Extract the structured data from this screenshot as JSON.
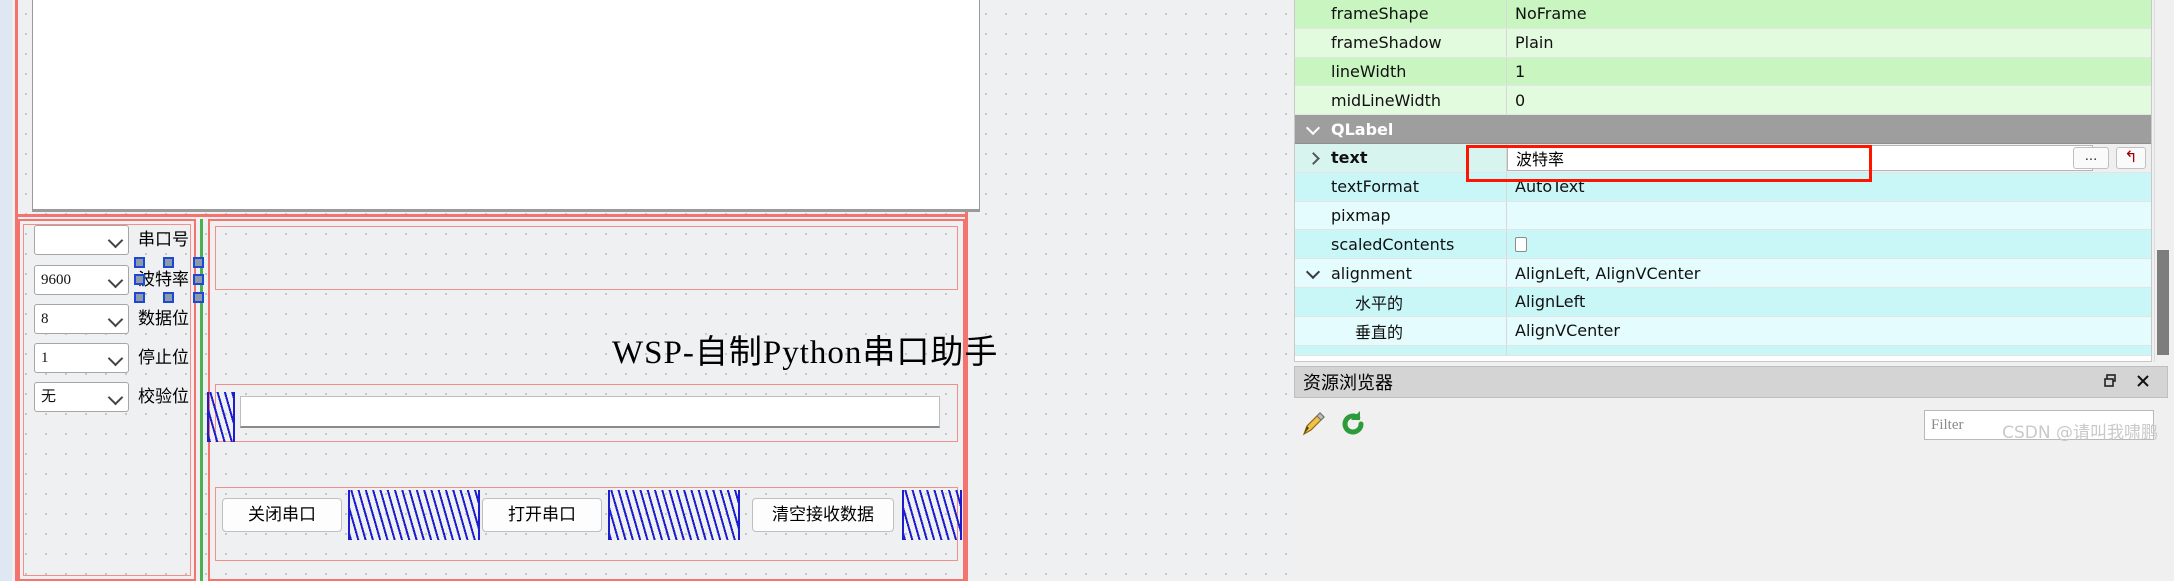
{
  "designer": {
    "form_title": "WSP-自制Python串口助手",
    "left_rows": [
      {
        "value": "",
        "label": "串口号"
      },
      {
        "value": "9600",
        "label": "波特率"
      },
      {
        "value": "8",
        "label": "数据位"
      },
      {
        "value": "1",
        "label": "停止位"
      },
      {
        "value": "无",
        "label": "校验位"
      }
    ],
    "buttons": [
      {
        "label": "关闭串口"
      },
      {
        "label": "打开串口"
      },
      {
        "label": "清空接收数据"
      }
    ],
    "selected_widget_label": "波特率"
  },
  "property_editor": {
    "rows_top": [
      {
        "name": "frameShape",
        "value": "NoFrame"
      },
      {
        "name": "frameShadow",
        "value": "Plain"
      },
      {
        "name": "lineWidth",
        "value": "1"
      },
      {
        "name": "midLineWidth",
        "value": "0"
      }
    ],
    "group": "QLabel",
    "text_row": {
      "name": "text",
      "value": "波特率",
      "ellipsis_label": "...",
      "reset_label": "↰"
    },
    "rows_mid": [
      {
        "name": "textFormat",
        "value": "AutoText"
      },
      {
        "name": "pixmap",
        "value": ""
      },
      {
        "name": "scaledContents",
        "value": ""
      }
    ],
    "alignment": {
      "name": "alignment",
      "value": "AlignLeft, AlignVCenter",
      "children": [
        {
          "name": "水平的",
          "value": "AlignLeft"
        },
        {
          "name": "垂直的",
          "value": "AlignVCenter"
        }
      ]
    },
    "highlight_color": "#ff1400"
  },
  "resource_browser": {
    "title": "资源浏览器",
    "restore_icon": "restore-icon",
    "close_icon": "close-icon",
    "edit_icon": "pencil-icon",
    "reload_icon": "reload-icon",
    "filter_placeholder": "Filter",
    "watermark": "CSDN @请叫我啸鹏"
  }
}
